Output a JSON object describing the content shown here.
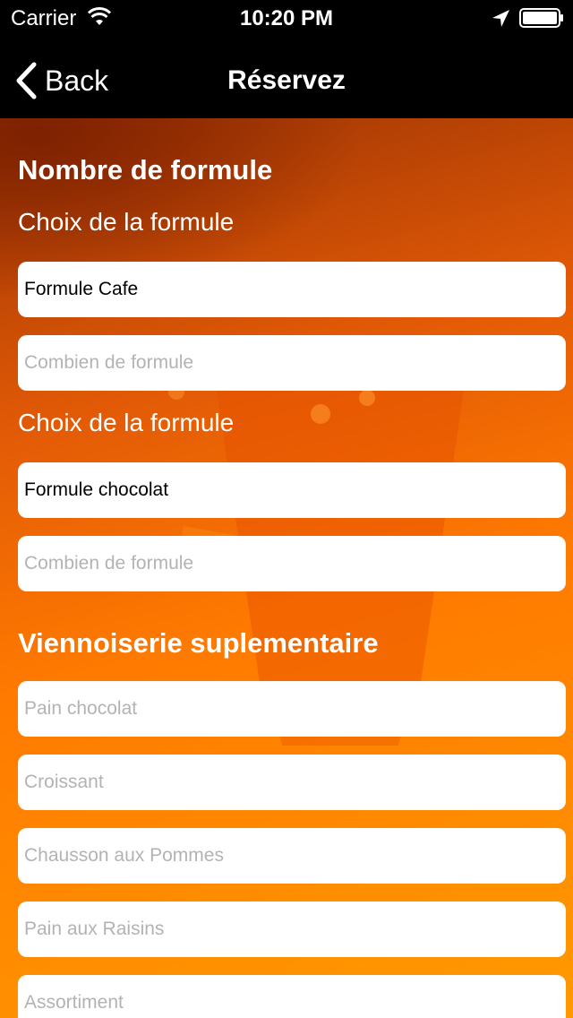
{
  "status_bar": {
    "carrier": "Carrier",
    "time": "10:20 PM",
    "icons": [
      "wifi-icon",
      "location-arrow-icon",
      "battery-icon"
    ]
  },
  "nav": {
    "back_label": "Back",
    "title": "Réservez"
  },
  "form": {
    "section1_title": "Nombre de formule",
    "choice1_label": "Choix de la formule",
    "choice1_value": "Formule Cafe",
    "qty1_placeholder": "Combien de formule",
    "choice2_label": "Choix de la formule",
    "choice2_value": "Formule chocolat",
    "qty2_placeholder": "Combien de formule",
    "section2_title": "Viennoiserie suplementaire",
    "extras": [
      {
        "placeholder": "Pain chocolat"
      },
      {
        "placeholder": "Croissant"
      },
      {
        "placeholder": "Chausson aux Pommes"
      },
      {
        "placeholder": "Pain aux Raisins"
      },
      {
        "placeholder": "Assortiment"
      }
    ]
  },
  "colors": {
    "bar_background": "#000000",
    "gradient_dark": "#9a3204",
    "gradient_light": "#ff8c00",
    "placeholder_text": "#b3b3b3"
  }
}
